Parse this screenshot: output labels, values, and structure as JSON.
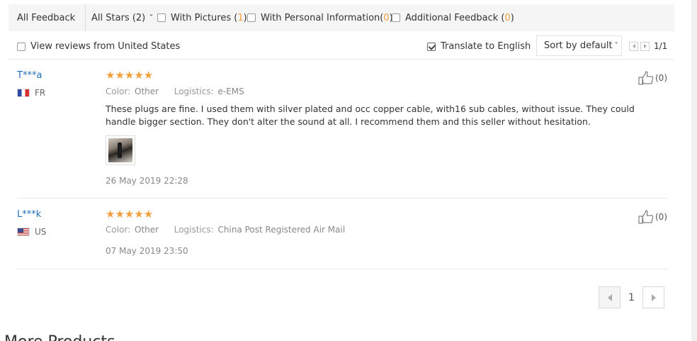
{
  "filters": {
    "all_feedback": "All Feedback",
    "all_stars": "All Stars (2)",
    "with_pictures_label": "With Pictures (",
    "with_pictures_count": "1",
    "with_pictures_close": ")",
    "personal_label": "With Personal Information(",
    "personal_count": "0",
    "personal_close": ")",
    "additional_label": "Additional Feedback (",
    "additional_count": "0",
    "additional_close": ")"
  },
  "options": {
    "local_reviews": "View reviews from United States",
    "translate": "Translate to English",
    "sort": "Sort by default",
    "page_indicator": "1/1"
  },
  "reviews": [
    {
      "user": "T***a",
      "country": "FR",
      "color_label": "Color:",
      "color_value": "Other",
      "logistics_label": "Logistics:",
      "logistics_value": "e-EMS",
      "text": "These plugs are fine. I used them with silver plated and occ copper cable, with16 sub cables, without issue. They could handle bigger section. They don't alter the sound at all. I recommend them and this seller without hesitation.",
      "date": "26 May 2019 22:28",
      "helpful": "(0)",
      "stars": 5
    },
    {
      "user": "L***k",
      "country": "US",
      "color_label": "Color:",
      "color_value": "Other",
      "logistics_label": "Logistics:",
      "logistics_value": "China Post Registered Air Mail",
      "date": "07 May 2019 23:50",
      "helpful": "(0)",
      "stars": 5
    }
  ],
  "pagination": {
    "current": "1"
  },
  "more_products": "More Products",
  "colors": {
    "accent": "#f2a03d",
    "link": "#1f6fb5"
  },
  "icons": [
    "chevron-down-icon",
    "thumbs-up-icon",
    "star-icon",
    "arrow-left-icon",
    "arrow-right-icon"
  ]
}
